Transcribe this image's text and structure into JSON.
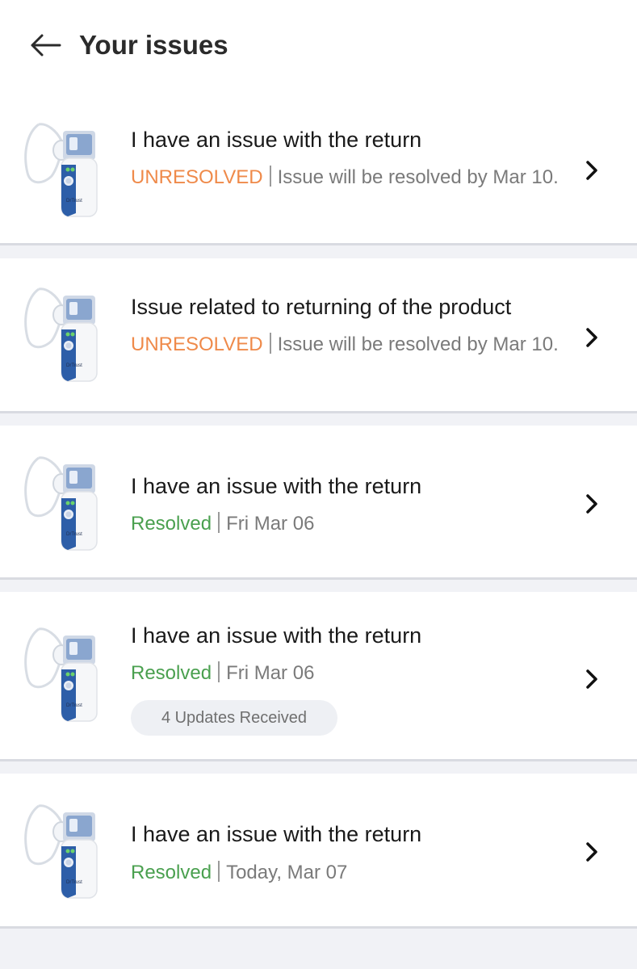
{
  "header": {
    "title": "Your issues",
    "back_icon": "arrow-left-icon"
  },
  "colors": {
    "unresolved": "#ef8a4a",
    "resolved": "#4aa04f",
    "background": "#f1f2f6"
  },
  "issues": [
    {
      "title": "I have an issue with the return",
      "status": "UNRESOLVED",
      "detail": "Issue will be resolved by Mar 10.",
      "icon": "nebulizer-product-image"
    },
    {
      "title": "Issue related to returning of the product",
      "status": "UNRESOLVED",
      "detail": "Issue will be resolved by Mar 10.",
      "icon": "nebulizer-product-image"
    },
    {
      "title": "I have an issue with the return",
      "status": "Resolved",
      "detail": "Fri Mar 06",
      "icon": "nebulizer-product-image"
    },
    {
      "title": "I have an issue with the return",
      "status": "Resolved",
      "detail": "Fri Mar 06",
      "updates": "4 Updates Received",
      "icon": "nebulizer-product-image"
    },
    {
      "title": "I have an issue with the return",
      "status": "Resolved",
      "detail": "Today, Mar 07",
      "icon": "nebulizer-product-image"
    }
  ],
  "product_brand": "DrTrust"
}
